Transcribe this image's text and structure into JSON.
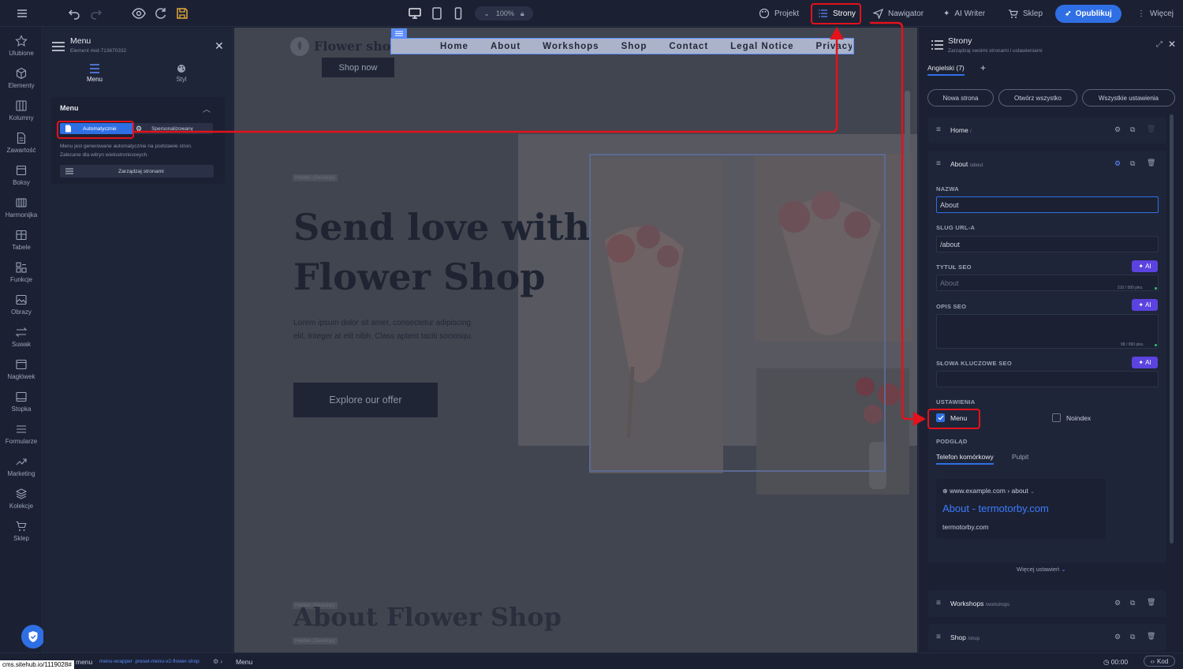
{
  "topbar": {
    "zoom": "100%",
    "projekt": "Projekt",
    "strony": "Strony",
    "nawigator": "Nawigator",
    "ai_writer": "AI Writer",
    "sklep": "Sklep",
    "opublikuj": "Opublikuj",
    "wiecej": "Więcej"
  },
  "rail": [
    {
      "label": "Ulubione",
      "icon": "star-icon"
    },
    {
      "label": "Elementy",
      "icon": "cube-icon"
    },
    {
      "label": "Kolumny",
      "icon": "columns-icon"
    },
    {
      "label": "Zawartość",
      "icon": "document-icon"
    },
    {
      "label": "Boksy",
      "icon": "box-icon"
    },
    {
      "label": "Harmonijka",
      "icon": "accordion-icon"
    },
    {
      "label": "Tabele",
      "icon": "table-icon"
    },
    {
      "label": "Funkcje",
      "icon": "functions-icon"
    },
    {
      "label": "Obrazy",
      "icon": "image-icon"
    },
    {
      "label": "Suwak",
      "icon": "slider-icon"
    },
    {
      "label": "Nagłówek",
      "icon": "header-icon"
    },
    {
      "label": "Stopka",
      "icon": "footer-icon"
    },
    {
      "label": "Formularze",
      "icon": "form-icon"
    },
    {
      "label": "Marketing",
      "icon": "trend-icon"
    },
    {
      "label": "Kolekcje",
      "icon": "layers-icon"
    },
    {
      "label": "Sklep",
      "icon": "cart-icon"
    }
  ],
  "panel": {
    "title": "Menu",
    "subtitle": "Element #ed-713670332",
    "tab_menu": "Menu",
    "tab_styl": "Styl",
    "section": "Menu",
    "opt_auto": "Automatycznie",
    "opt_custom": "Spersonalizowany",
    "help": "Menu jest generowane automatycznie na podstawie stron. Zalecane dla witryn wielostronicowych.",
    "manage": "Zarządzaj stronami"
  },
  "canvas": {
    "logo": "Flower shop",
    "nav": [
      "Home",
      "About",
      "Workshops",
      "Shop",
      "Contact",
      "Legal Notice",
      "Privacy"
    ],
    "shop_now": "Shop now",
    "hidden_tag": "Hidden (Desktop)",
    "hero_line1": "Send love with",
    "hero_line2": "Flower Shop",
    "hero_text": "Lorem ipsum dolor sit amet, consectetur adipiscing elit. Integer at elit nibh. Class aptent taciti sociosqu.",
    "cta": "Explore our offer",
    "about_title": "About Flower Shop"
  },
  "pages": {
    "title": "Strony",
    "subtitle": "Zarządzaj swoimi stronami i ustawieniami",
    "lang_tab": "Angielski (7)",
    "btn_new": "Nowa strona",
    "btn_open": "Otwórz wszystko",
    "btn_settings": "Wszystkie ustawienia",
    "home_name": "Home",
    "home_slug": "/",
    "about_name": "About",
    "about_slug": "/about",
    "lbl_name": "NAZWA",
    "name_value": "About",
    "lbl_slug": "SLUG URL-A",
    "slug_value": "/about",
    "lbl_seo_title": "TYTUŁ SEO",
    "seo_title_placeholder": "About",
    "seo_title_count": "210 / 580 piks.",
    "lbl_seo_desc": "OPIS SEO",
    "seo_desc_count": "98 / 990 piks.",
    "lbl_keywords": "SŁOWA KLUCZOWE SEO",
    "ai": "AI",
    "lbl_settings": "USTAWIENIA",
    "chk_menu": "Menu",
    "chk_noindex": "Noindex",
    "lbl_preview": "PODGLĄD",
    "tab_mobile": "Telefon komórkowy",
    "tab_desktop": "Pulpit",
    "preview_url": "www.example.com › about",
    "preview_title": "About - termotorby.com",
    "preview_domain": "termotorby.com",
    "more_settings": "Więcej ustawień",
    "workshops_name": "Workshops",
    "workshops_slug": "/workshops",
    "shop_name": "Shop",
    "shop_slug": "/shop"
  },
  "status": {
    "url": "cms.sitehub.io/1119028#",
    "crumb1": "menu",
    "crumb2": "menu-wrapper .preset-menu-v2-flower-shop",
    "crumb3": "Menu",
    "time": "00:00",
    "kod": "Kod"
  },
  "colors": {
    "accent": "#2f6fe4",
    "ai": "#5b43e0",
    "highlight": "#e3121b"
  }
}
